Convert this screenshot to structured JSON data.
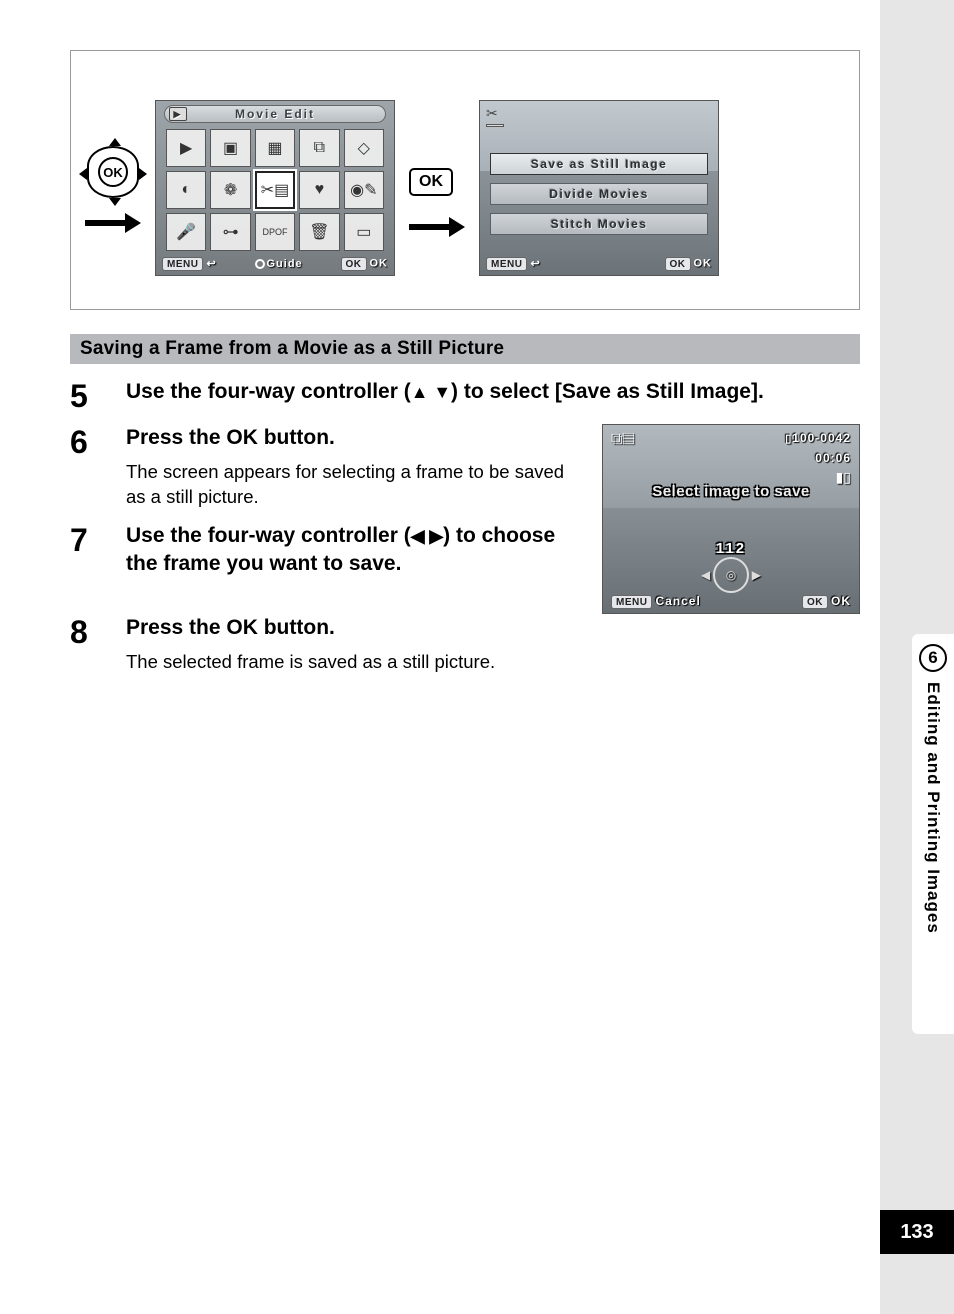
{
  "sidebar": {
    "chapter_number": "6",
    "chapter_title": "Editing and Printing Images"
  },
  "page_number": "133",
  "diagram": {
    "ok_label": "OK",
    "lcd1": {
      "title": "Movie Edit",
      "footer_menu_badge": "MENU",
      "footer_menu_icon": "↩",
      "footer_guide": "Guide",
      "footer_ok_badge": "OK",
      "footer_ok": "OK"
    },
    "ok_button_label": "OK",
    "lcd2": {
      "opt1": "Save as Still Image",
      "opt2": "Divide Movies",
      "opt3": "Stitch Movies",
      "footer_menu_badge": "MENU",
      "footer_menu_icon": "↩",
      "footer_ok_badge": "OK",
      "footer_ok": "OK"
    }
  },
  "section_header": "Saving a Frame from a Movie as a Still Picture",
  "steps": {
    "s5": {
      "num": "5",
      "title_pre": "Use the four-way controller (",
      "title_arrows": "▲ ▼",
      "title_post": ") to select [Save as Still Image]."
    },
    "s6": {
      "num": "6",
      "title_pre": "Press the ",
      "title_ok": "OK",
      "title_post": " button.",
      "body": "The screen appears for selecting a frame to be saved as a still picture."
    },
    "s7": {
      "num": "7",
      "title_pre": "Use the four-way controller (",
      "title_arrows": "◀ ▶",
      "title_post": ") to choose the frame you want to save."
    },
    "s8": {
      "num": "8",
      "title_pre": "Press the ",
      "title_ok": "OK",
      "title_post": " button.",
      "body": "The selected frame is saved as a still picture."
    }
  },
  "frame_lcd": {
    "file": "100-0042",
    "time": "00:06",
    "prompt": "Select image to save",
    "frame_number": "112",
    "cancel_badge": "MENU",
    "cancel": "Cancel",
    "ok_badge": "OK",
    "ok": "OK"
  }
}
